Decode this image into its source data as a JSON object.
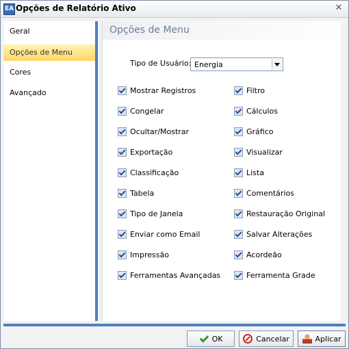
{
  "window": {
    "title": "Opções de Relatório Ativo",
    "app_icon_text": "EA"
  },
  "sidebar": {
    "items": [
      {
        "label": "Geral",
        "active": false
      },
      {
        "label": "Opções de Menu",
        "active": true
      },
      {
        "label": "Cores",
        "active": false
      },
      {
        "label": "Avançado",
        "active": false
      }
    ]
  },
  "main": {
    "section_title": "Opções de Menu",
    "user_type_label": "Tipo de Usuário:",
    "user_type_value": "Energia",
    "left_options": [
      {
        "label": "Mostrar Registros",
        "checked": true
      },
      {
        "label": "Congelar",
        "checked": true
      },
      {
        "label": "Ocultar/Mostrar",
        "checked": true
      },
      {
        "label": "Exportação",
        "checked": true
      },
      {
        "label": "Classificação",
        "checked": true
      },
      {
        "label": "Tabela",
        "checked": true
      },
      {
        "label": "Tipo de Janela",
        "checked": true
      },
      {
        "label": "Enviar como Email",
        "checked": true
      },
      {
        "label": "Impressão",
        "checked": true
      },
      {
        "label": "Ferramentas Avançadas",
        "checked": true
      }
    ],
    "right_options": [
      {
        "label": "Filtro",
        "checked": true
      },
      {
        "label": "Cálculos",
        "checked": true
      },
      {
        "label": "Gráfico",
        "checked": true
      },
      {
        "label": "Visualizar",
        "checked": true
      },
      {
        "label": "Lista",
        "checked": true
      },
      {
        "label": "Comentários",
        "checked": true
      },
      {
        "label": "Restauração Original",
        "checked": true
      },
      {
        "label": "Salvar Alterações",
        "checked": true
      },
      {
        "label": "Acordeão",
        "checked": true
      },
      {
        "label": "Ferramenta Grade",
        "checked": true
      }
    ]
  },
  "footer": {
    "ok_label": "OK",
    "cancel_label": "Cancelar",
    "apply_label": "Aplicar"
  },
  "colors": {
    "accent": "#4f7fc0",
    "active_tab": "#ffd766"
  },
  "icons": {
    "ok": "check-icon",
    "cancel": "no-entry-icon",
    "apply": "user-icon",
    "close": "close-icon"
  }
}
